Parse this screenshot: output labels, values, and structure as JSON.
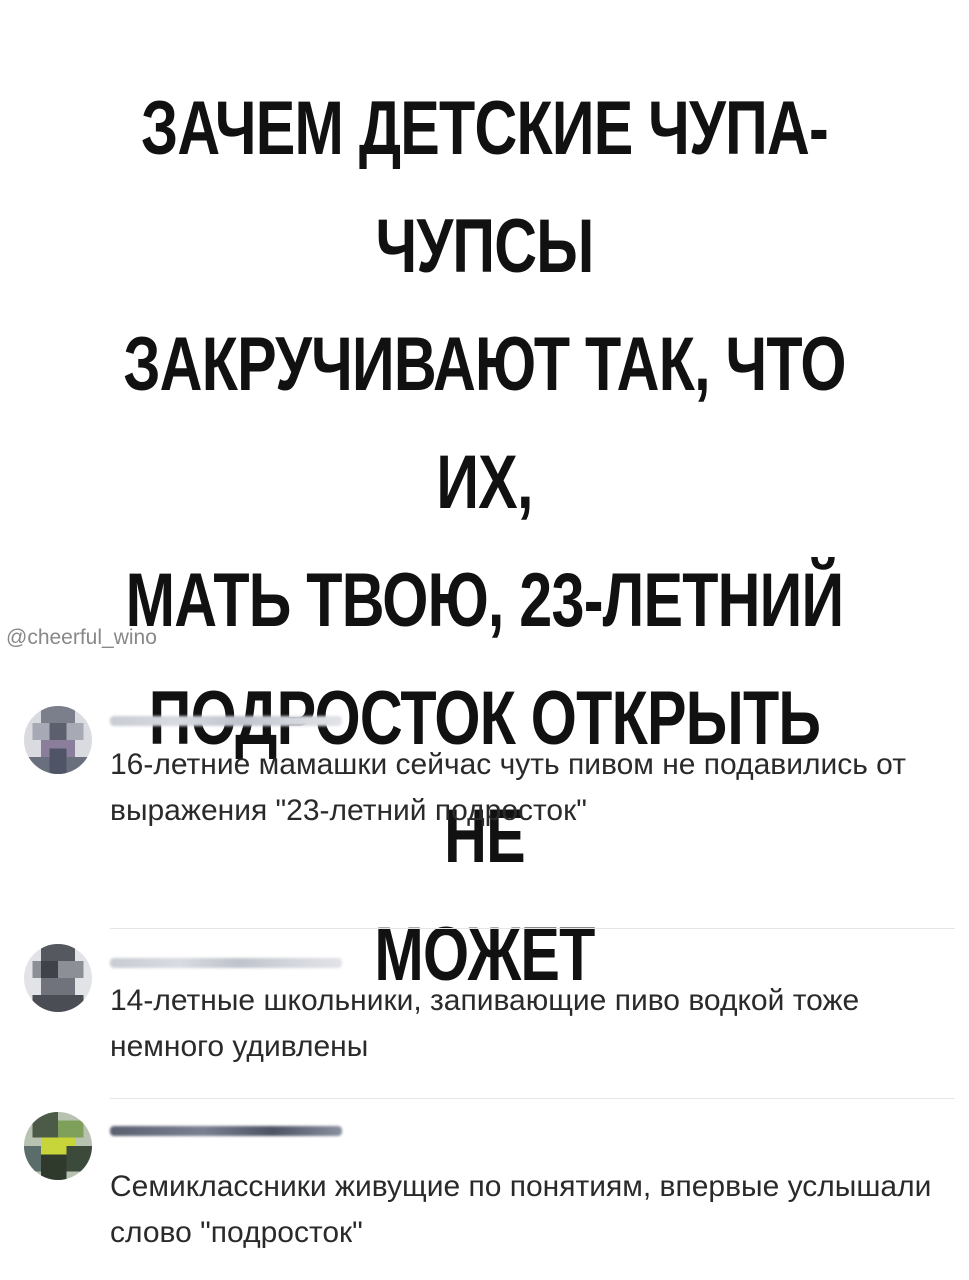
{
  "headline": {
    "lines": [
      "ЗАЧЕМ ДЕТСКИЕ ЧУПА-ЧУПСЫ",
      "ЗАКРУЧИВАЮТ ТАК, ЧТО ИХ,",
      "МАТЬ ТВОЮ, 23-ЛЕТНИЙ",
      "ПОДРОСТОК ОТКРЫТЬ НЕ",
      "МОЖЕТ"
    ]
  },
  "watermark": "@cheerful_wino",
  "comments": [
    {
      "author": "",
      "text": "16-летние мамашки сейчас чуть пивом не подавились от выражения \"23-летний подросток\""
    },
    {
      "author": "",
      "text": "14-летные школьники, запивающие пиво водкой тоже немного удивлены"
    },
    {
      "author": "",
      "text": "Семиклассники живущие по понятиям, впервые услышали слово \"подросток\""
    }
  ],
  "colors": {
    "background": "#ffffff",
    "headline": "#111111",
    "comment_text": "#2a2a2a",
    "watermark": "#888888"
  }
}
